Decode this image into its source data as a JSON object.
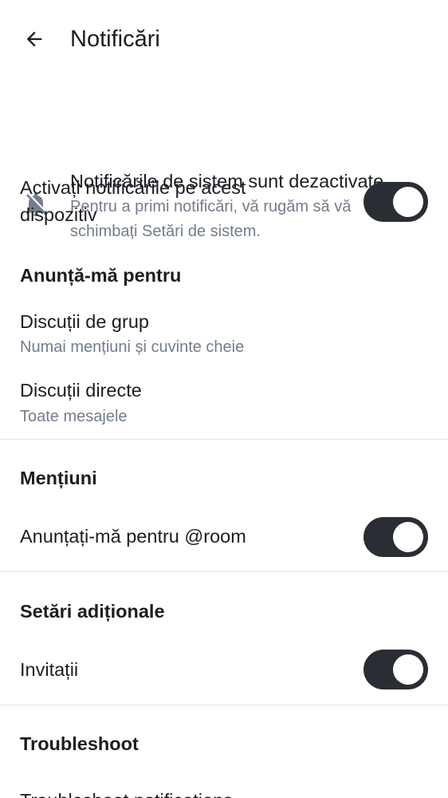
{
  "appbar": {
    "title": "Notificări"
  },
  "system_banner": {
    "title": "Notificările de sistem sunt dezactivate",
    "description": "Pentru a primi notificări, vă rugăm să vă schimbați Setări de sistem."
  },
  "device": {
    "label": "Activați notificările pe acest dispozitiv",
    "enabled": true
  },
  "notify_for": {
    "header": "Anunță-mă pentru",
    "items": [
      {
        "title": "Discuții de grup",
        "value": "Numai mențiuni și cuvinte cheie"
      },
      {
        "title": "Discuții directe",
        "value": "Toate mesajele"
      }
    ]
  },
  "mentions": {
    "header": "Mențiuni",
    "room_label": "Anunțați-mă pentru @room",
    "room_enabled": true
  },
  "additional": {
    "header": "Setări adiționale",
    "invites_label": "Invitații",
    "invites_enabled": true
  },
  "troubleshoot": {
    "header": "Troubleshoot",
    "item_label": "Troubleshoot notifications"
  },
  "colors": {
    "toggle_on": "#2a2d34",
    "secondary_text": "#737d8c",
    "divider": "#e3e5e8"
  }
}
